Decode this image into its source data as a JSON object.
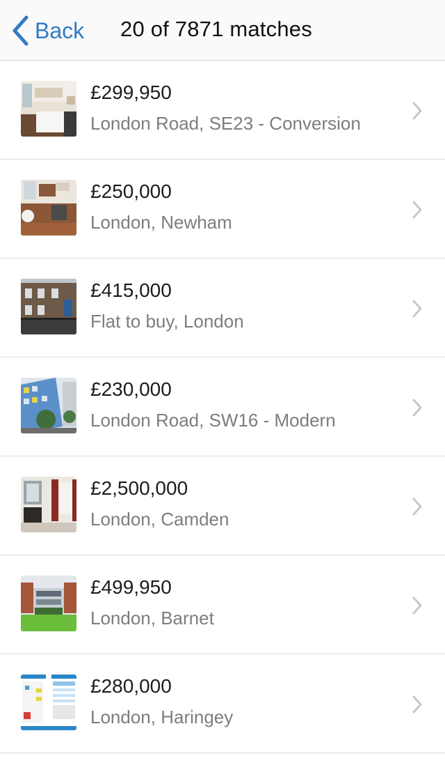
{
  "nav": {
    "back_label": "Back",
    "title": "20 of 7871 matches",
    "accent_color": "#2f7cc4"
  },
  "listings": [
    {
      "price": "£299,950",
      "description": "London Road, SE23 - Conversion",
      "thumb_icon": "kitchen-photo"
    },
    {
      "price": "£250,000",
      "description": "London, Newham",
      "thumb_icon": "kitchen-photo"
    },
    {
      "price": "£415,000",
      "description": "Flat to buy, London",
      "thumb_icon": "brick-building-photo"
    },
    {
      "price": "£230,000",
      "description": "London Road, SW16 - Modern",
      "thumb_icon": "modern-building-photo"
    },
    {
      "price": "£2,500,000",
      "description": "London, Camden",
      "thumb_icon": "living-room-photo"
    },
    {
      "price": "£499,950",
      "description": "London, Barnet",
      "thumb_icon": "building-lawn-photo"
    },
    {
      "price": "£280,000",
      "description": "London, Haringey",
      "thumb_icon": "floorplan-document-photo"
    }
  ]
}
